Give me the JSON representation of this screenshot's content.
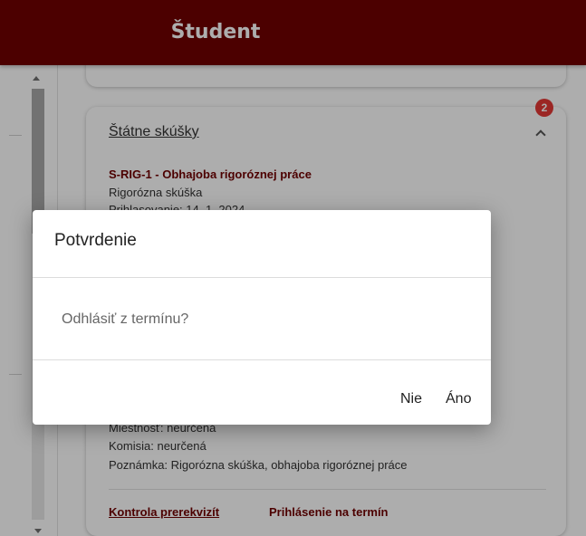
{
  "header": {
    "title": "Študent"
  },
  "card": {
    "badge_count": "2",
    "title": "Štátne skúšky",
    "exam": {
      "code_name": "S-RIG-1 - Obhajoba rigoróznej práce",
      "type": "Rigorózna skúška",
      "registration": "Prihlasovanie:   14. 1. 2024",
      "room": "Miestnosť: neurčená",
      "committee": "Komisia: neurčená",
      "note": "Poznámka: Rigorózna skúška, obhajoba rigoróznej práce"
    },
    "actions": {
      "prerequisites": "Kontrola prerekvizít",
      "register": "Prihlásenie na termín"
    }
  },
  "dialog": {
    "title": "Potvrdenie",
    "message": "Odhlásiť z termínu?",
    "no_label": "Nie",
    "yes_label": "Áno"
  },
  "colors": {
    "brand": "#700000",
    "badge": "#e53935"
  }
}
